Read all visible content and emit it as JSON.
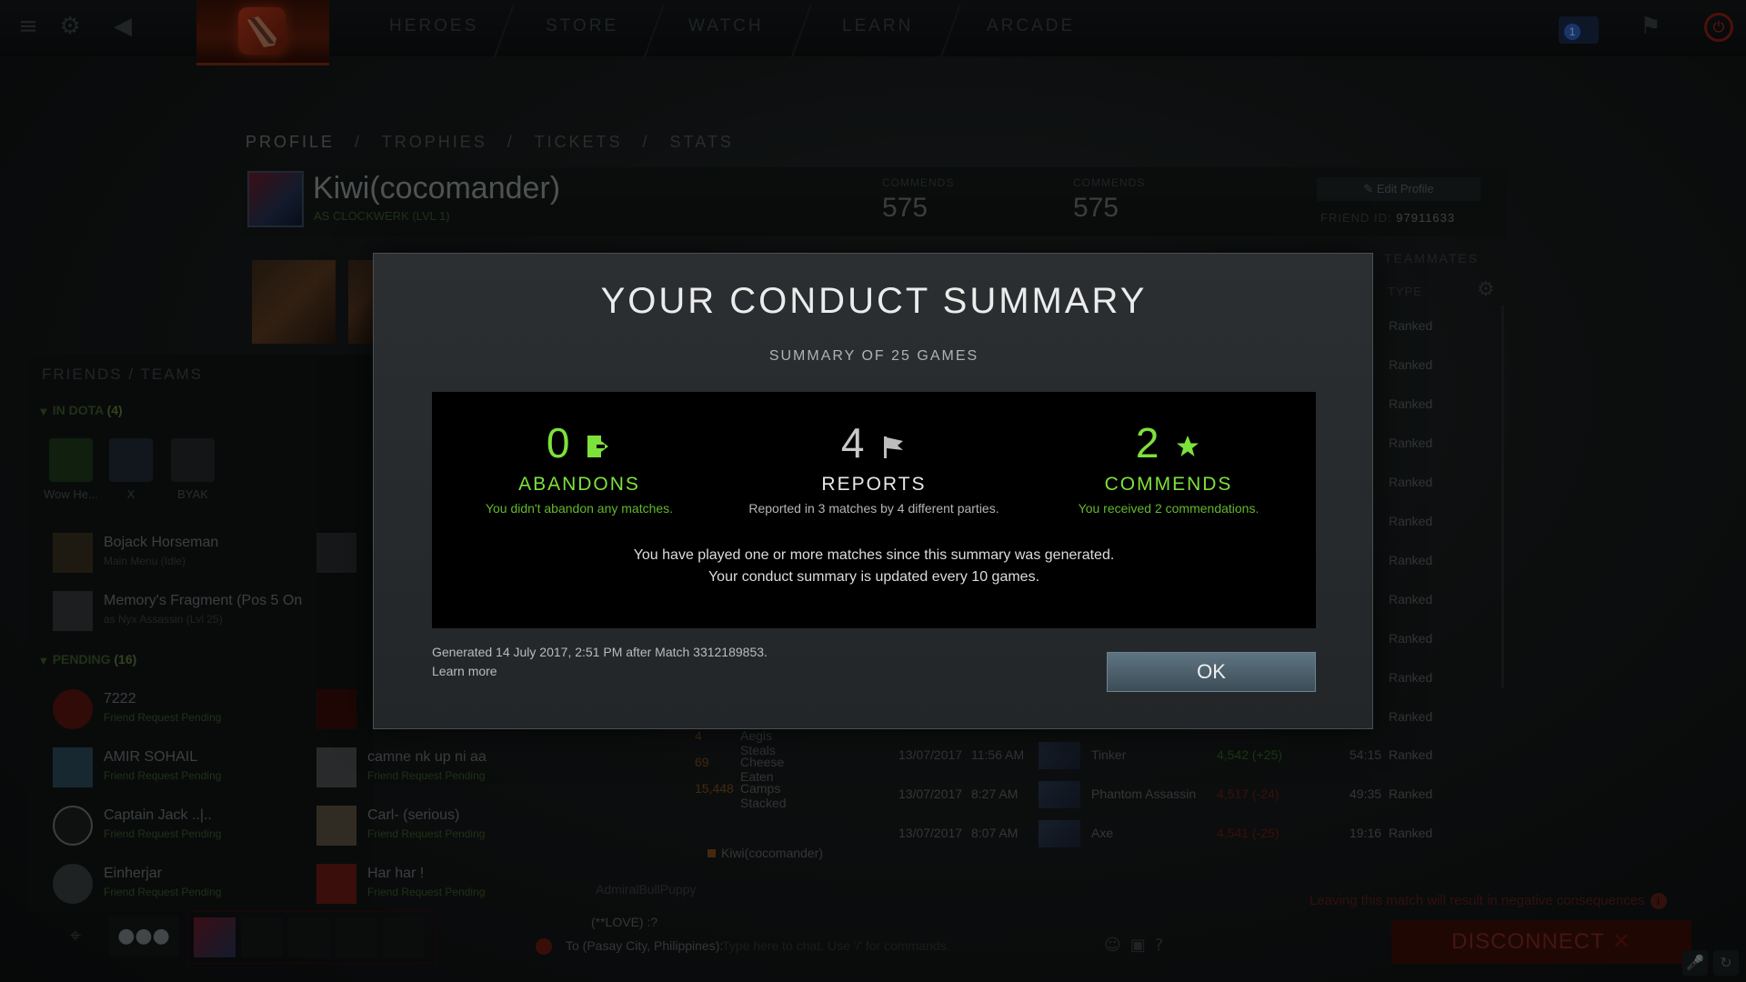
{
  "nav": {
    "items": [
      "HEROES",
      "STORE",
      "WATCH",
      "LEARN",
      "ARCADE"
    ],
    "notification_count": "1"
  },
  "profile": {
    "tabs": [
      "PROFILE",
      "/",
      "TROPHIES",
      "/",
      "TICKETS",
      "/",
      "STATS"
    ],
    "name": "Kiwi(cocomander)",
    "subtitle": "AS CLOCKWERK (LVL 1)",
    "stat1_label": "COMMENDS",
    "stat1_value": "575",
    "stat2_label": "COMMENDS",
    "stat2_value": "575",
    "edit_label": "Edit Profile",
    "friend_id_label": "FRIEND ID:",
    "friend_id": "97911633",
    "teammates_label": "TEAMMATES",
    "type_header": "TYPE",
    "ranked_label": "Ranked"
  },
  "matches": [
    {
      "date": "13/07/2017",
      "time": "11:56 AM",
      "hero": "Tinker",
      "mmr": "4,542 (+25)",
      "duration": "54:15",
      "type": "Ranked"
    },
    {
      "date": "13/07/2017",
      "time": "8:27 AM",
      "hero": "Phantom Assassin",
      "mmr": "4,517 (-24)",
      "duration": "49:35",
      "type": "Ranked"
    },
    {
      "date": "13/07/2017",
      "time": "8:07 AM",
      "hero": "Axe",
      "mmr": "4,541 (-25)",
      "duration": "19:16",
      "type": "Ranked"
    }
  ],
  "stats": [
    {
      "n": "4",
      "t": "Aegis Steals"
    },
    {
      "n": "69",
      "t": "Cheese Eaten"
    },
    {
      "n": "15,448",
      "t": "Camps Stacked"
    }
  ],
  "chat": {
    "name": "Kiwi(cocomander)",
    "line1": "AdmiralBullPuppy",
    "line2": "(**LOVE) :?",
    "to_label": "To (Pasay City, Philippines):",
    "placeholder": "Type here to chat. Use '/' for commands."
  },
  "disconnect": {
    "warning": "Leaving this match will result in negative consequences",
    "label": "DISCONNECT"
  },
  "friends": {
    "tabs": "FRIENDS  /  TEAMS",
    "in_dota_label": "IN DOTA",
    "in_dota_count": "(4)",
    "in_dota": [
      {
        "name": "Wow He..."
      },
      {
        "name": "X"
      },
      {
        "name": "BYAK"
      }
    ],
    "online": [
      {
        "name": "Bojack Horseman",
        "status": "Main Menu (Idle)"
      },
      {
        "name": "Memory's Fragment (Pos 5 On",
        "status": "as Nyx Assassin (Lvl 25)"
      }
    ],
    "pending_label": "PENDING",
    "pending_count": "(16)",
    "pending": [
      {
        "name": "7222",
        "status": "Friend Request Pending"
      },
      {
        "name": "AMIR SOHAIL",
        "status": "Friend Request Pending"
      },
      {
        "name": "camne nk up ni aa",
        "status": "Friend Request Pending"
      },
      {
        "name": "Captain Jack ..|..",
        "status": "Friend Request Pending"
      },
      {
        "name": "Carl- (serious)",
        "status": "Friend Request Pending"
      },
      {
        "name": "Einherjar",
        "status": "Friend Request Pending"
      },
      {
        "name": "Har har !",
        "status": "Friend Request Pending"
      }
    ]
  },
  "modal": {
    "title": "YOUR CONDUCT SUMMARY",
    "subtitle": "SUMMARY OF 25 GAMES",
    "abandons": {
      "value": "0",
      "label": "ABANDONS",
      "desc": "You didn't abandon any matches."
    },
    "reports": {
      "value": "4",
      "label": "REPORTS",
      "desc": "Reported in 3 matches by 4 different parties."
    },
    "commends": {
      "value": "2",
      "label": "COMMENDS",
      "desc": "You received 2 commendations."
    },
    "note_line1": "You have played one or more matches since this summary was generated.",
    "note_line2": "Your conduct summary is updated every 10 games.",
    "generated": "Generated 14 July 2017, 2:51 PM after Match 3312189853.",
    "learn_more": "Learn more",
    "ok_label": "OK"
  },
  "colors": {
    "green": "#7de13c",
    "ok_button": "#4f6370",
    "disconnect": "#3a0d08"
  }
}
